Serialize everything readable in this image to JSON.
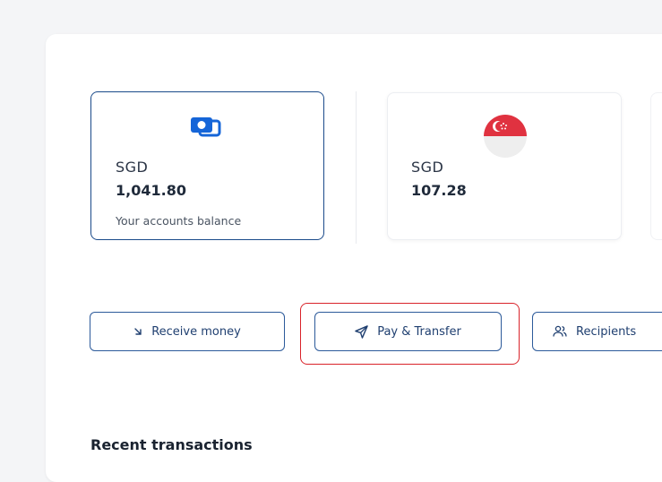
{
  "accounts": [
    {
      "currency": "SGD",
      "amount": "1,041.80",
      "caption": "Your accounts balance",
      "icon": "wallet-icon"
    },
    {
      "currency": "SGD",
      "amount": "107.28",
      "icon": "singapore-flag-icon"
    }
  ],
  "actions": {
    "receive_label": "Receive money",
    "pay_label": "Pay & Transfer",
    "recipients_label": "Recipients"
  },
  "recent": {
    "title": "Recent transactions"
  },
  "colors": {
    "primary": "#1a4a8a",
    "accent_blue": "#1565d8",
    "highlight_red": "#d9232a",
    "flag_red": "#e03240"
  }
}
